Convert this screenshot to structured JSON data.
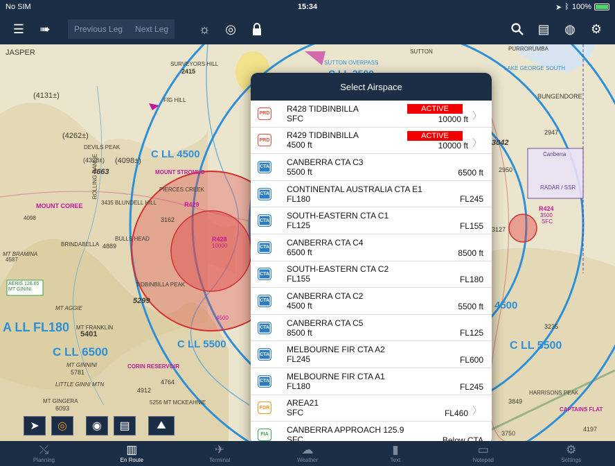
{
  "status_bar": {
    "carrier": "No SIM",
    "time": "15:34",
    "battery": "100%"
  },
  "toolbar": {
    "previous_leg": "Previous Leg",
    "next_leg": "Next Leg"
  },
  "map": {
    "labels": [
      {
        "text": "JASPER"
      },
      {
        "text": "(4131±)"
      },
      {
        "text": "SURVEYORS HILL"
      },
      {
        "text": "2415"
      },
      {
        "text": "FIG HILL"
      },
      {
        "text": "(4262±)"
      },
      {
        "text": "DEVILS PEAK"
      },
      {
        "text": "(4328±)"
      },
      {
        "text": "(4098±)"
      },
      {
        "text": "4663"
      },
      {
        "text": "MOUNT STROMLO"
      },
      {
        "text": "PIERCES CREEK"
      },
      {
        "text": "MOUNT COREE"
      },
      {
        "text": "4098"
      },
      {
        "text": "3435 BLUNDELL HILL"
      },
      {
        "text": "3162"
      },
      {
        "text": "BULLS HEAD"
      },
      {
        "text": "4889"
      },
      {
        "text": "MT BRAMINA"
      },
      {
        "text": "4587"
      },
      {
        "text": "TIDBINBILLA PEAK"
      },
      {
        "text": "5299"
      },
      {
        "text": "MT AGGIE"
      },
      {
        "text": "MT FRANKLIN"
      },
      {
        "text": "5401"
      },
      {
        "text": "MT GINNINI"
      },
      {
        "text": "5781"
      },
      {
        "text": "LITTLE GINNI MTN"
      },
      {
        "text": "CORIN RESERVOIR"
      },
      {
        "text": "4764"
      },
      {
        "text": "4912"
      },
      {
        "text": "MT GINGERA"
      },
      {
        "text": "6093"
      },
      {
        "text": "5256 MT MCKEAHNIE"
      },
      {
        "text": "SUTTON OVERPASS"
      },
      {
        "text": "SUTTON"
      },
      {
        "text": "BUNGENDORE"
      },
      {
        "text": "LAKE GEORGE SOUTH"
      },
      {
        "text": "PURRORUMBA"
      },
      {
        "text": "3042"
      },
      {
        "text": "2947"
      },
      {
        "text": "2950"
      },
      {
        "text": "3235"
      },
      {
        "text": "3849"
      },
      {
        "text": "HARRISONS PEAK"
      },
      {
        "text": "CAPTAINS FLAT"
      },
      {
        "text": "4197"
      },
      {
        "text": "3750"
      },
      {
        "text": "3127"
      },
      {
        "text": "BRINDABELLA"
      },
      {
        "text": "ROLLING RANGE"
      },
      {
        "text": "R429"
      },
      {
        "text": "R428"
      },
      {
        "text": "R424"
      },
      {
        "text": "3500"
      },
      {
        "text": "SFC"
      },
      {
        "text": "10000"
      },
      {
        "text": "4500"
      },
      {
        "text": "AERIS 128.65 MT GININI"
      },
      {
        "text": "RADAR / SSR"
      },
      {
        "text": "Canberra"
      }
    ],
    "blue_labels": [
      {
        "text": "C LL 4500"
      },
      {
        "text": "C LL 3500"
      },
      {
        "text": "A LL FL180"
      },
      {
        "text": "C LL 6500"
      },
      {
        "text": "C LL 5500"
      },
      {
        "text": "C LL 5500"
      },
      {
        "text": "4500"
      }
    ]
  },
  "popover": {
    "title": "Select Airspace",
    "rows": [
      {
        "badge": "PRD",
        "kind": "prd",
        "name": "R428 TIDBINBILLA",
        "lower": "SFC",
        "upper": "10000 ft",
        "status": "ACTIVE",
        "chevron": true
      },
      {
        "badge": "PRD",
        "kind": "prd",
        "name": "R429 TIDBINBILLA",
        "lower": "4500 ft",
        "upper": "10000 ft",
        "status": "ACTIVE",
        "chevron": true
      },
      {
        "badge": "CTA",
        "kind": "cta",
        "name": "CANBERRA CTA C3",
        "lower": "5500 ft",
        "upper": "6500 ft"
      },
      {
        "badge": "CTA",
        "kind": "cta",
        "name": "CONTINENTAL AUSTRALIA CTA E1",
        "lower": "FL180",
        "upper": "FL245"
      },
      {
        "badge": "CTA",
        "kind": "cta",
        "name": "SOUTH-EASTERN CTA C1",
        "lower": "FL125",
        "upper": "FL155"
      },
      {
        "badge": "CTA",
        "kind": "cta",
        "name": "CANBERRA CTA C4",
        "lower": "6500 ft",
        "upper": "8500 ft"
      },
      {
        "badge": "CTA",
        "kind": "cta",
        "name": "SOUTH-EASTERN CTA C2",
        "lower": "FL155",
        "upper": "FL180"
      },
      {
        "badge": "CTA",
        "kind": "cta",
        "name": "CANBERRA CTA C2",
        "lower": "4500 ft",
        "upper": "5500 ft"
      },
      {
        "badge": "CTA",
        "kind": "cta",
        "name": "CANBERRA CTA C5",
        "lower": "8500 ft",
        "upper": "FL125"
      },
      {
        "badge": "CTA",
        "kind": "cta",
        "name": "MELBOURNE FIR CTA A2",
        "lower": "FL245",
        "upper": "FL600"
      },
      {
        "badge": "CTA",
        "kind": "cta",
        "name": "MELBOURNE FIR CTA A1",
        "lower": "FL180",
        "upper": "FL245"
      },
      {
        "badge": "FDR",
        "kind": "fdr",
        "name": "AREA21",
        "lower": "SFC",
        "upper": "FL460",
        "chevron": true
      },
      {
        "badge": "FIA",
        "kind": "fia",
        "name": "CANBERRA APPROACH 125.9",
        "lower": "SFC",
        "upper": "Below CTA"
      }
    ]
  },
  "tabs": [
    {
      "label": "Planning",
      "icon": "planning-icon"
    },
    {
      "label": "En Route",
      "icon": "map-icon",
      "selected": true
    },
    {
      "label": "Terminal",
      "icon": "airplane-icon"
    },
    {
      "label": "Weather",
      "icon": "cloud-icon"
    },
    {
      "label": "Text",
      "icon": "book-icon"
    },
    {
      "label": "Notepad",
      "icon": "notepad-icon"
    },
    {
      "label": "Settings",
      "icon": "gear-icon"
    }
  ],
  "colors": {
    "bar": "#1c2e46",
    "active": "#f20000",
    "prd": "#e24b3a",
    "cta": "#2b7cc0",
    "fdr": "#f0961e",
    "fia": "#36a64a",
    "airspace_blue": "#2d8fd8",
    "restricted_fill": "#e04a4a"
  }
}
